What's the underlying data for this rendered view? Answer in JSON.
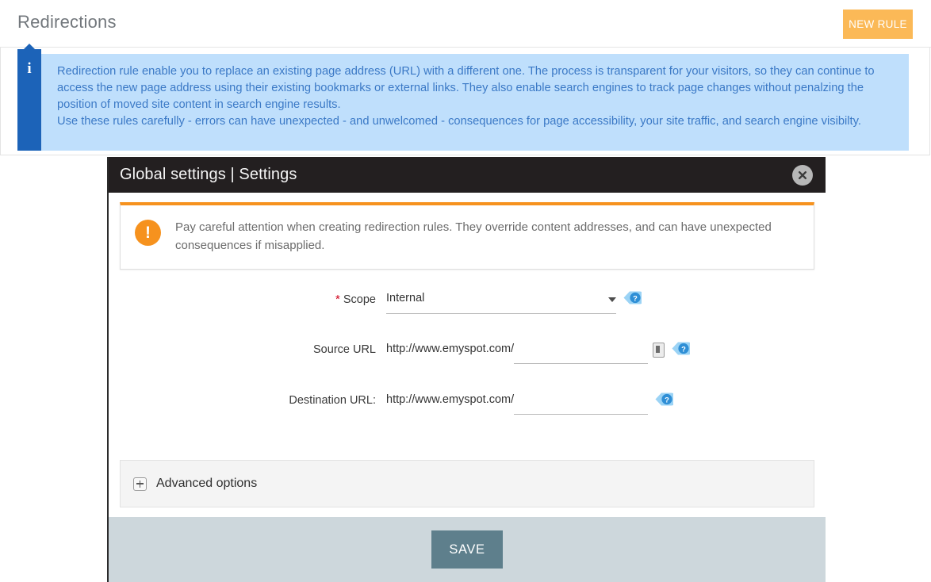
{
  "header": {
    "title": "Redirections",
    "new_rule_label": "NEW RULE",
    "new_rule_color": "#fbb957"
  },
  "info_banner": {
    "icon": "info-icon",
    "icon_glyph": "i",
    "background_color": "#bfdffc",
    "text_color": "#3b79c6",
    "paragraphs": [
      "Redirection rule enable you to replace an existing page address (URL) with a different one. The process is transparent for your visitors, so they can continue to access the new page address using their existing bookmarks or external links. They also enable search engines to track page changes without penalzing the position of moved site content in search engine results.",
      "Use these rules carefully - errors can have unexpected - and unwelcomed - consequences for page accessibility, your site traffic, and search engine visibilty."
    ]
  },
  "modal": {
    "title": "Global settings | Settings",
    "header_color": "#231f20",
    "close_label": "close",
    "warning": {
      "accent_color": "#f6921e",
      "icon_glyph": "!",
      "text": "Pay careful attention when creating redirection rules. They override content addresses, and can have unexpected consequences if misapplied."
    },
    "form": {
      "scope": {
        "label": "Scope",
        "required": true,
        "required_marker": "*",
        "value": "Internal",
        "options": [
          "Internal"
        ],
        "help_icon": "help-icon"
      },
      "source_url": {
        "label": "Source URL",
        "prefix": "http://www.emyspot.com/",
        "value": "",
        "placeholder": "",
        "picker_icon": "page-picker-icon",
        "help_icon": "help-icon"
      },
      "destination_url": {
        "label": "Destination URL:",
        "prefix": "http://www.emyspot.com/",
        "value": "",
        "placeholder": "",
        "help_icon": "help-icon"
      }
    },
    "advanced_options": {
      "label": "Advanced options",
      "icon": "plus-box-icon",
      "expanded": false
    },
    "footer": {
      "save_label": "SAVE",
      "save_color": "#5e7f8c",
      "background_color": "#cdd7dc"
    }
  }
}
